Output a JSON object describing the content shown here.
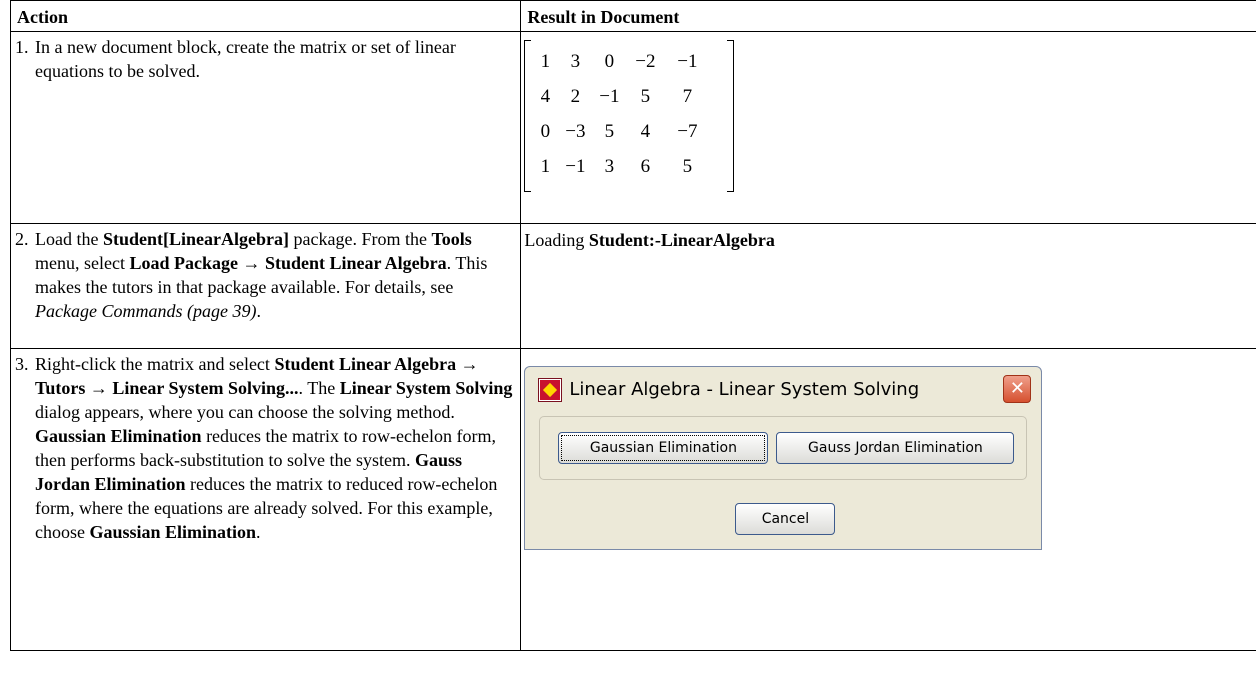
{
  "table": {
    "headers": [
      "Action",
      "Result in Document"
    ],
    "step1": {
      "num": "1.",
      "text": "In a new document block, create the matrix or set of linear equations to be solved."
    },
    "matrix": [
      [
        "1",
        "3",
        "0",
        "−2",
        "−1"
      ],
      [
        "4",
        "2",
        "−1",
        "5",
        "7"
      ],
      [
        "0",
        "−3",
        "5",
        "4",
        "−7"
      ],
      [
        "1",
        "−1",
        "3",
        "6",
        "5"
      ]
    ],
    "step2": {
      "num": "2.",
      "t1": "Load the ",
      "b1": "Student[LinearAlgebra]",
      "t2": " package. From the ",
      "b2": "Tools",
      "t3": " menu, select ",
      "b3": "Load Package → Student Linear Algebra",
      "t4": ". This makes the tutors in that package available. For details, see ",
      "i1": "Package Commands (page 39)",
      "t5": ".",
      "result_text": "Loading ",
      "result_bold": "Student:-LinearAlgebra"
    },
    "step3": {
      "num": "3.",
      "t1": "Right-click the matrix and select ",
      "b1": "Student Linear Algebra → Tutors → Linear System Solving...",
      "t2": ". The ",
      "b2": "Linear System Solving",
      "t3": " dialog appears, where you can choose the solving method. ",
      "b3": "Gaussian Elimination",
      "t4": " reduces the matrix to row-echelon form, then performs back-substitution to solve the system. ",
      "b4": "Gauss Jordan Elimination",
      "t5": " reduces the matrix to reduced row-echelon form, where the equations are already solved. For this example, choose ",
      "b5": "Gaussian Elimination",
      "t6": "."
    }
  },
  "dialog": {
    "title": "Linear Algebra - Linear System Solving",
    "close_glyph": "✕",
    "gaussian_button": "Gaussian Elimination",
    "gauss_jordan_button": "Gauss Jordan Elimination",
    "cancel_button": "Cancel",
    "colors": {
      "close": "#d6502f",
      "frame": "#ece9d8",
      "icon": "#c8102e"
    },
    "icon": "maple-leaf-icon"
  }
}
